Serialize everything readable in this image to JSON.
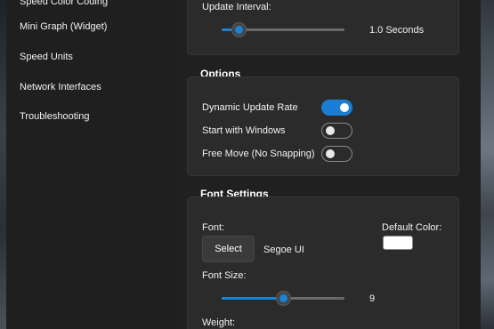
{
  "sidebar": {
    "items": [
      {
        "label": "Speed Color Coding"
      },
      {
        "label": "Mini Graph (Widget)"
      },
      {
        "label": "Speed Units"
      },
      {
        "label": "Network Interfaces"
      },
      {
        "label": "Troubleshooting"
      }
    ]
  },
  "update": {
    "label": "Update Interval:",
    "value_text": "1.0 Seconds",
    "slider_fraction": 0.14
  },
  "options": {
    "title": "Options",
    "items": [
      {
        "label": "Dynamic Update Rate",
        "on": true
      },
      {
        "label": "Start with Windows",
        "on": false
      },
      {
        "label": "Free Move (No Snapping)",
        "on": false
      }
    ]
  },
  "font_settings": {
    "title": "Font Settings",
    "font_label": "Font:",
    "select_label": "Select",
    "font_name": "Segoe UI",
    "default_color_label": "Default Color:",
    "default_color": "#ffffff",
    "font_size_label": "Font Size:",
    "font_size_value": "9",
    "font_size_fraction": 0.5,
    "weight_label": "Weight:"
  },
  "colors": {
    "accent": "#1883d7",
    "window_bg": "#1f1f1f",
    "card_bg": "#2b2b2b"
  }
}
